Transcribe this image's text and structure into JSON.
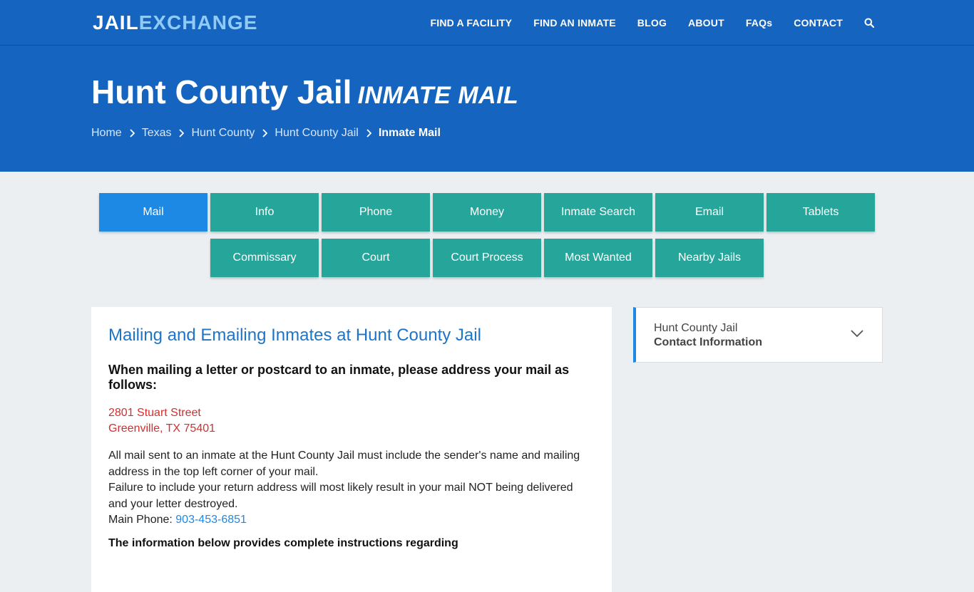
{
  "logo": {
    "part1": "JAIL",
    "part2": "EXCHANGE"
  },
  "nav": {
    "items": [
      "FIND A FACILITY",
      "FIND AN INMATE",
      "BLOG",
      "ABOUT",
      "FAQs",
      "CONTACT"
    ],
    "search_icon": "search-icon"
  },
  "hero": {
    "title": "Hunt County Jail",
    "subtitle": "Inmate Mail"
  },
  "breadcrumb": [
    "Home",
    "Texas",
    "Hunt County",
    "Hunt County Jail",
    "Inmate Mail"
  ],
  "tabs": {
    "row1": [
      "Mail",
      "Info",
      "Phone",
      "Money",
      "Inmate Search",
      "Email",
      "Tablets"
    ],
    "row2": [
      "Commissary",
      "Court",
      "Court Process",
      "Most Wanted",
      "Nearby Jails"
    ],
    "active": "Mail"
  },
  "content": {
    "heading": "Mailing and Emailing Inmates at Hunt County Jail",
    "subheading": "When mailing a letter or postcard to an inmate, please address your mail as follows:",
    "address_line1": "2801 Stuart Street",
    "address_line2": "Greenville, TX 75401",
    "para1": "All mail sent to an inmate at the Hunt County Jail must include the sender's name and mailing address in the top left corner of your mail.",
    "para2": "Failure to include your return address will most likely result in your mail NOT being delivered and your letter destroyed.",
    "phone_label": "Main Phone: ",
    "phone": "903-453-6851",
    "info_line": "The information below provides complete instructions regarding"
  },
  "sidebar": {
    "line1": "Hunt County Jail",
    "line2": "Contact Information"
  },
  "colors": {
    "header_blue": "#1565c0",
    "tab_teal": "#26a69a",
    "tab_active": "#1e88e5",
    "heading_blue": "#1e74c6",
    "address_red": "#d32f2f"
  }
}
